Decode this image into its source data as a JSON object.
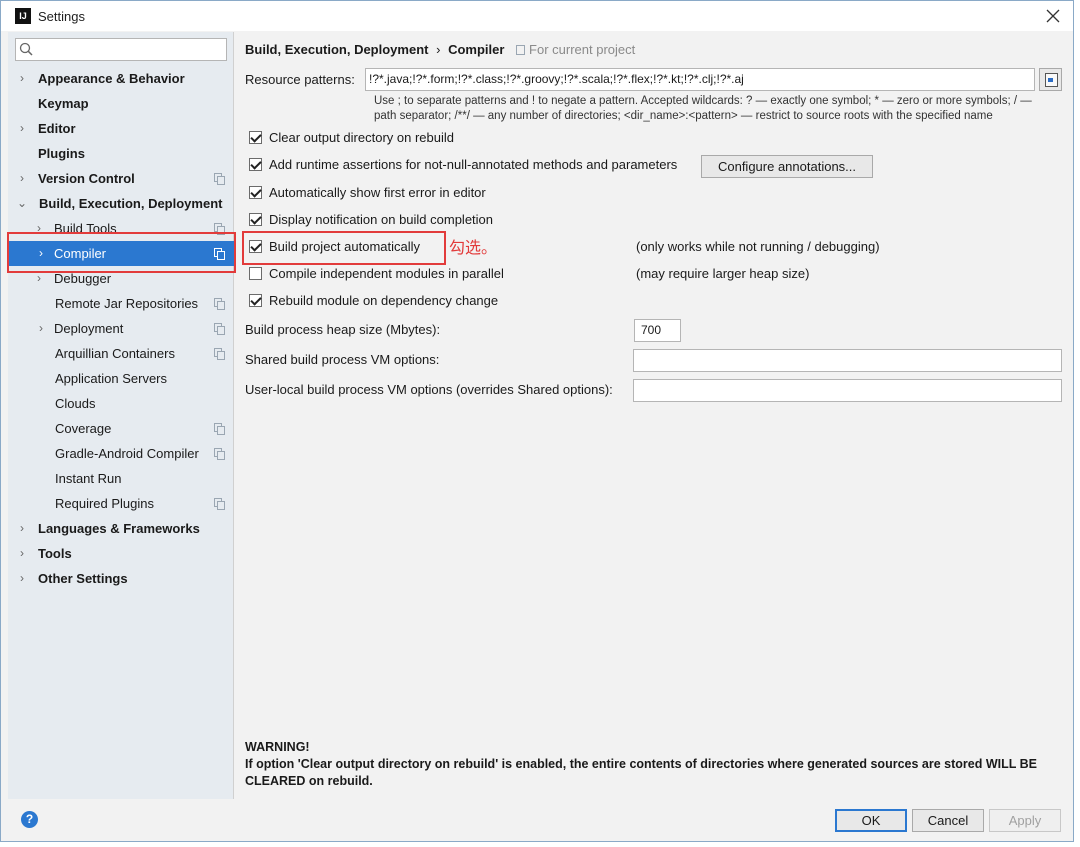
{
  "window": {
    "title": "Settings",
    "app_icon": "IJ"
  },
  "search": {
    "placeholder": ""
  },
  "sidebar": {
    "items": [
      {
        "label": "Appearance & Behavior",
        "arrow": "›",
        "copy": false
      },
      {
        "label": "Keymap",
        "arrow": "",
        "copy": false
      },
      {
        "label": "Editor",
        "arrow": "›",
        "copy": false
      },
      {
        "label": "Plugins",
        "arrow": "",
        "copy": false
      },
      {
        "label": "Version Control",
        "arrow": "›",
        "copy": true
      },
      {
        "label": "Build, Execution, Deployment",
        "arrow": "⌄",
        "copy": false
      },
      {
        "label": "Build Tools",
        "arrow": "›",
        "copy": true
      },
      {
        "label": "Compiler",
        "arrow": "›",
        "copy": true
      },
      {
        "label": "Debugger",
        "arrow": "›",
        "copy": false
      },
      {
        "label": "Remote Jar Repositories",
        "arrow": "",
        "copy": true
      },
      {
        "label": "Deployment",
        "arrow": "›",
        "copy": true
      },
      {
        "label": "Arquillian Containers",
        "arrow": "",
        "copy": true
      },
      {
        "label": "Application Servers",
        "arrow": "",
        "copy": false
      },
      {
        "label": "Clouds",
        "arrow": "",
        "copy": false
      },
      {
        "label": "Coverage",
        "arrow": "",
        "copy": true
      },
      {
        "label": "Gradle-Android Compiler",
        "arrow": "",
        "copy": true
      },
      {
        "label": "Instant Run",
        "arrow": "",
        "copy": false
      },
      {
        "label": "Required Plugins",
        "arrow": "",
        "copy": true
      },
      {
        "label": "Languages & Frameworks",
        "arrow": "›",
        "copy": false
      },
      {
        "label": "Tools",
        "arrow": "›",
        "copy": false
      },
      {
        "label": "Other Settings",
        "arrow": "›",
        "copy": false
      }
    ]
  },
  "breadcrumb": {
    "parent": "Build, Execution, Deployment",
    "separator": "›",
    "current": "Compiler",
    "scope": "For current project"
  },
  "resource": {
    "label": "Resource patterns:",
    "value": "!?*.java;!?*.form;!?*.class;!?*.groovy;!?*.scala;!?*.flex;!?*.kt;!?*.clj;!?*.aj",
    "hint_line1": "Use ; to separate patterns and ! to negate a pattern. Accepted wildcards: ? — exactly one symbol; * — zero or more symbols; / —",
    "hint_line2": "path separator; /**/ — any number of directories; <dir_name>:<pattern> — restrict to source roots with the specified name"
  },
  "options": [
    {
      "label": "Clear output directory on rebuild",
      "checked": true,
      "note": ""
    },
    {
      "label": "Add runtime assertions for not-null-annotated methods and parameters",
      "checked": true,
      "note": ""
    },
    {
      "label": "Automatically show first error in editor",
      "checked": true,
      "note": ""
    },
    {
      "label": "Display notification on build completion",
      "checked": true,
      "note": ""
    },
    {
      "label": "Build project automatically",
      "checked": true,
      "note": "(only works while not running / debugging)"
    },
    {
      "label": "Compile independent modules in parallel",
      "checked": false,
      "note": "(may require larger heap size)"
    },
    {
      "label": "Rebuild module on dependency change",
      "checked": true,
      "note": ""
    }
  ],
  "configure_button": "Configure annotations...",
  "heap": {
    "label": "Build process heap size (Mbytes):",
    "value": "700"
  },
  "shared_vm": {
    "label": "Shared build process VM options:",
    "value": ""
  },
  "user_vm": {
    "label": "User-local build process VM options (overrides Shared options):",
    "value": ""
  },
  "warning": {
    "title": "WARNING!",
    "text": "If option 'Clear output directory on rebuild' is enabled, the entire contents of directories where generated sources are stored WILL BE CLEARED on rebuild."
  },
  "annotation": {
    "text": "勾选。",
    "color": "#e23b3b"
  },
  "footer": {
    "ok": "OK",
    "cancel": "Cancel",
    "apply": "Apply",
    "help": "?"
  },
  "colors": {
    "selection": "#2b78d0",
    "sidebar_bg": "#e6ebf0",
    "annotation": "#e23b3b"
  }
}
